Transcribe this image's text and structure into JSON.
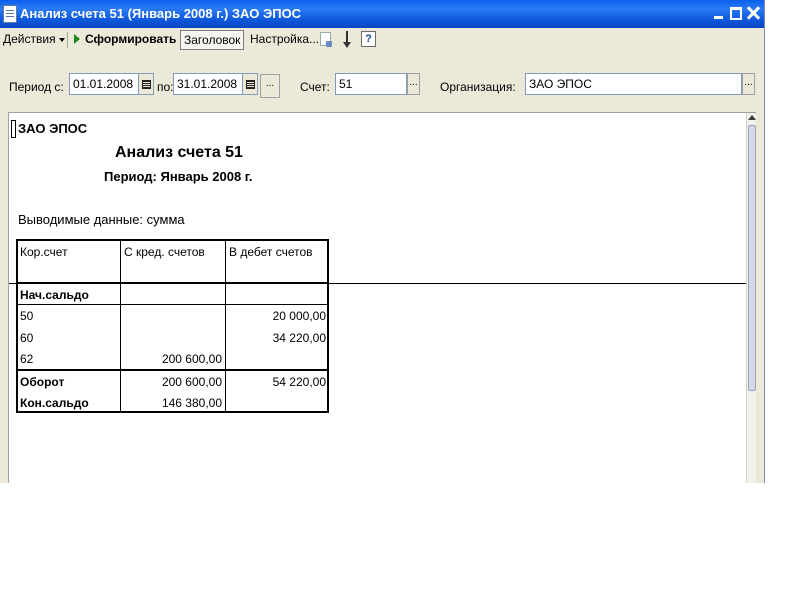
{
  "window": {
    "title": "Анализ счета 51 (Январь 2008 г.) ЗАО ЭПОС"
  },
  "toolbar": {
    "actions_label": "Действия",
    "generate_label": "Сформировать",
    "header_label": "Заголовок",
    "settings_label": "Настройка...",
    "help_label": "?"
  },
  "params": {
    "period_from_label": "Период с:",
    "period_from_value": "01.01.2008",
    "period_to_label": "по:",
    "period_to_value": "31.01.2008",
    "more_label": "...",
    "account_label": "Счет:",
    "account_value": "51",
    "org_label": "Организация:",
    "org_value": "ЗАО ЭПОС"
  },
  "report": {
    "org": "ЗАО ЭПОС",
    "title": "Анализ счета 51",
    "period": "Период: Январь 2008 г.",
    "output": "Выводимые данные: сумма",
    "table": {
      "headers": [
        "Кор.счет",
        "С кред. счетов",
        "В дебет счетов"
      ],
      "rows": [
        {
          "acc": "Нач.сальдо",
          "credit": "",
          "debit": ""
        },
        {
          "acc": "50",
          "credit": "",
          "debit": "20 000,00"
        },
        {
          "acc": "60",
          "credit": "",
          "debit": "34 220,00"
        },
        {
          "acc": "62",
          "credit": "200 600,00",
          "debit": ""
        },
        {
          "acc": "Оборот",
          "credit": "200 600,00",
          "debit": "54 220,00"
        },
        {
          "acc": "Кон.сальдо",
          "credit": "146 380,00",
          "debit": ""
        }
      ]
    }
  }
}
